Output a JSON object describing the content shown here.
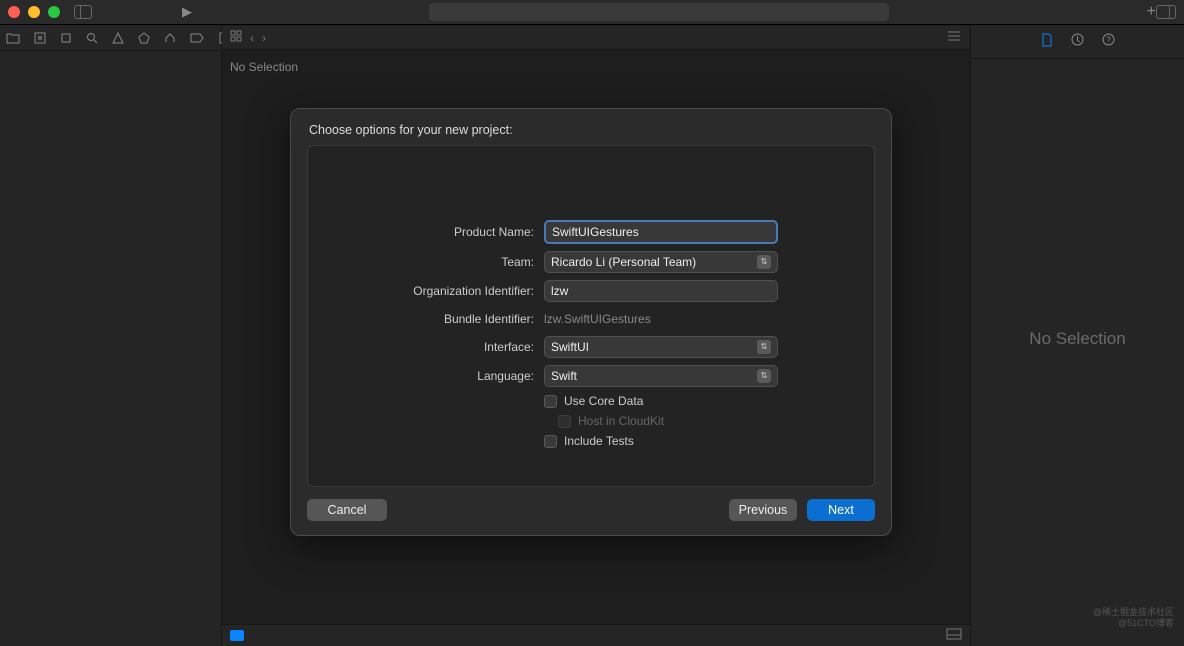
{
  "titlebar": {
    "run_icon": "▶"
  },
  "editor_bar": {
    "no_selection": "No Selection"
  },
  "inspector": {
    "no_selection": "No Selection"
  },
  "modal": {
    "title": "Choose options for your new project:",
    "labels": {
      "product_name": "Product Name:",
      "team": "Team:",
      "org_identifier": "Organization Identifier:",
      "bundle_identifier": "Bundle Identifier:",
      "interface": "Interface:",
      "language": "Language:"
    },
    "values": {
      "product_name": "SwiftUIGestures",
      "team": "Ricardo Li (Personal Team)",
      "org_identifier": "lzw",
      "bundle_identifier": "lzw.SwiftUIGestures",
      "interface": "SwiftUI",
      "language": "Swift"
    },
    "checkboxes": {
      "core_data": "Use Core Data",
      "cloudkit": "Host in CloudKit",
      "include_tests": "Include Tests"
    },
    "buttons": {
      "cancel": "Cancel",
      "previous": "Previous",
      "next": "Next"
    }
  },
  "watermark": {
    "line1": "@稀土掘金技术社区",
    "line2": "@51CTO博客"
  }
}
